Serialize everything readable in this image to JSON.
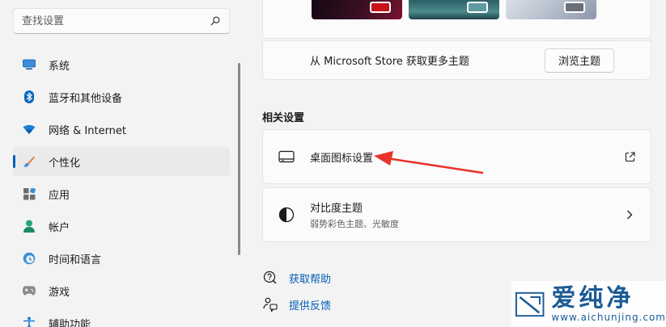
{
  "search": {
    "placeholder": "查找设置"
  },
  "nav": {
    "items": [
      {
        "label": "系统",
        "icon": "monitor-icon",
        "active": false
      },
      {
        "label": "蓝牙和其他设备",
        "icon": "bluetooth-icon",
        "active": false
      },
      {
        "label": "网络 & Internet",
        "icon": "wifi-icon",
        "active": false
      },
      {
        "label": "个性化",
        "icon": "brush-icon",
        "active": true
      },
      {
        "label": "应用",
        "icon": "apps-icon",
        "active": false
      },
      {
        "label": "帐户",
        "icon": "person-icon",
        "active": false
      },
      {
        "label": "时间和语言",
        "icon": "globe-clock-icon",
        "active": false
      },
      {
        "label": "游戏",
        "icon": "gamepad-icon",
        "active": false
      },
      {
        "label": "辅助功能",
        "icon": "accessibility-icon",
        "active": false
      }
    ]
  },
  "themes": {
    "store_text": "从 Microsoft Store 获取更多主题",
    "browse_button": "浏览主题"
  },
  "related": {
    "title": "相关设置",
    "desktop_icons": {
      "title": "桌面图标设置",
      "icon": "desktop-icon",
      "end_icon": "external-link-icon"
    },
    "contrast": {
      "title": "对比度主题",
      "subtitle": "弱势彩色主题、光敏度",
      "icon": "contrast-icon",
      "end_icon": "chevron-right-icon"
    }
  },
  "links": {
    "help": "获取帮助",
    "feedback": "提供反馈"
  },
  "watermark": {
    "cn": "爱纯净",
    "en": "www.aichunjing.com"
  },
  "colors": {
    "accent": "#005fb8",
    "arrow": "#e8342b"
  }
}
